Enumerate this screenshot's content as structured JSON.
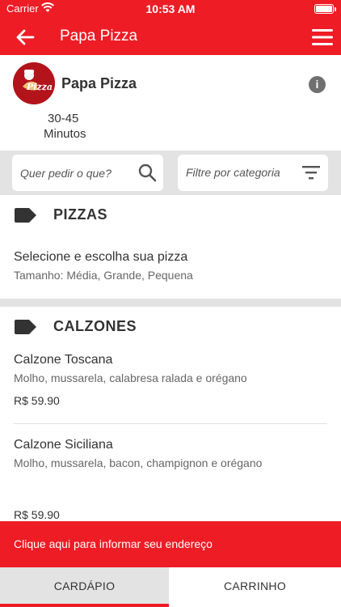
{
  "status_bar": {
    "carrier": "Carrier",
    "time": "10:53 AM"
  },
  "nav": {
    "title": "Papa Pizza",
    "icons": {
      "back": "arrow-left-icon",
      "menu": "hamburger-menu-icon"
    }
  },
  "store": {
    "name": "Papa Pizza",
    "logo_text": "Pizza",
    "eta_time": "30-45",
    "eta_unit": "Minutos",
    "icons": {
      "info": "info-icon"
    }
  },
  "filters": {
    "search_placeholder": "Quer pedir o que?",
    "category_label": "Filtre por categoria",
    "icons": {
      "search": "search-icon",
      "filter": "filter-icon"
    }
  },
  "sections": [
    {
      "title": "PIZZAS",
      "items": [
        {
          "name": "Selecione e escolha sua pizza",
          "description": "Tamanho: Média, Grande, Pequena"
        }
      ]
    },
    {
      "title": "CALZONES",
      "items": [
        {
          "name": "Calzone Toscana",
          "description": "Molho, mussarela, calabresa ralada e orégano",
          "price": "R$ 59.90"
        },
        {
          "name": "Calzone Siciliana",
          "description": "Molho, mussarela, bacon, champignon e orégano",
          "price": "R$ 59.90"
        }
      ]
    }
  ],
  "address_prompt": "Clique aqui para informar seu endereço",
  "tabs": [
    {
      "label": "CARDÁPIO",
      "active": true
    },
    {
      "label": "CARRINHO",
      "active": false
    }
  ],
  "colors": {
    "brand": "#ee1c25",
    "background_gray": "#e3e3e3",
    "text": "#333333"
  }
}
